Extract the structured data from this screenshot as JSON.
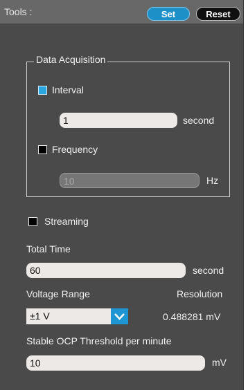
{
  "header": {
    "title": "Tools :",
    "set_label": "Set",
    "reset_label": "Reset"
  },
  "acquisition": {
    "group_title": "Data Acquisition",
    "interval": {
      "label": "Interval",
      "checked": true,
      "value": "1",
      "unit": "second"
    },
    "frequency": {
      "label": "Frequency",
      "checked": false,
      "value": "10",
      "unit": "Hz",
      "disabled": true
    }
  },
  "streaming": {
    "label": "Streaming",
    "checked": false
  },
  "total_time": {
    "label": "Total Time",
    "value": "60",
    "unit": "second"
  },
  "voltage": {
    "label": "Voltage Range",
    "selected": "±1 V",
    "resolution_label": "Resolution",
    "resolution_value": "0.488281 mV"
  },
  "ocp": {
    "label": "Stable OCP Threshold per minute",
    "value": "10",
    "unit": "mV"
  },
  "colors": {
    "panel": "#4a4a4a",
    "titlebar": "#686868",
    "accent": "#1e90c8"
  }
}
